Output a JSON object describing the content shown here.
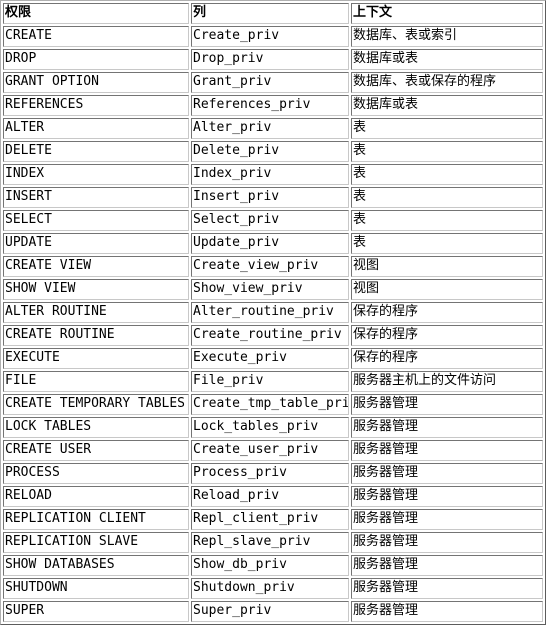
{
  "table": {
    "columns": [
      {
        "key": "privilege",
        "label": "权限"
      },
      {
        "key": "column",
        "label": "列"
      },
      {
        "key": "context",
        "label": "上下文"
      }
    ],
    "rows": [
      {
        "privilege": "CREATE",
        "column": "Create_priv",
        "context": "数据库、表或索引"
      },
      {
        "privilege": "DROP",
        "column": "Drop_priv",
        "context": "数据库或表"
      },
      {
        "privilege": "GRANT OPTION",
        "column": "Grant_priv",
        "context": "数据库、表或保存的程序"
      },
      {
        "privilege": "REFERENCES",
        "column": "References_priv",
        "context": "数据库或表"
      },
      {
        "privilege": "ALTER",
        "column": "Alter_priv",
        "context": "表"
      },
      {
        "privilege": "DELETE",
        "column": "Delete_priv",
        "context": "表"
      },
      {
        "privilege": "INDEX",
        "column": "Index_priv",
        "context": "表"
      },
      {
        "privilege": "INSERT",
        "column": "Insert_priv",
        "context": "表"
      },
      {
        "privilege": "SELECT",
        "column": "Select_priv",
        "context": "表"
      },
      {
        "privilege": "UPDATE",
        "column": "Update_priv",
        "context": "表"
      },
      {
        "privilege": "CREATE VIEW",
        "column": "Create_view_priv",
        "context": "视图"
      },
      {
        "privilege": "SHOW VIEW",
        "column": "Show_view_priv",
        "context": "视图"
      },
      {
        "privilege": "ALTER ROUTINE",
        "column": "Alter_routine_priv",
        "context": "保存的程序"
      },
      {
        "privilege": "CREATE ROUTINE",
        "column": "Create_routine_priv",
        "context": "保存的程序"
      },
      {
        "privilege": "EXECUTE",
        "column": "Execute_priv",
        "context": "保存的程序"
      },
      {
        "privilege": "FILE",
        "column": "File_priv",
        "context": "服务器主机上的文件访问"
      },
      {
        "privilege": "CREATE TEMPORARY TABLES",
        "column": "Create_tmp_table_priv",
        "context": "服务器管理"
      },
      {
        "privilege": "LOCK TABLES",
        "column": "Lock_tables_priv",
        "context": "服务器管理"
      },
      {
        "privilege": "CREATE USER",
        "column": "Create_user_priv",
        "context": "服务器管理"
      },
      {
        "privilege": "PROCESS",
        "column": "Process_priv",
        "context": "服务器管理"
      },
      {
        "privilege": "RELOAD",
        "column": "Reload_priv",
        "context": "服务器管理"
      },
      {
        "privilege": "REPLICATION CLIENT",
        "column": "Repl_client_priv",
        "context": "服务器管理"
      },
      {
        "privilege": "REPLICATION SLAVE",
        "column": "Repl_slave_priv",
        "context": "服务器管理"
      },
      {
        "privilege": "SHOW DATABASES",
        "column": "Show_db_priv",
        "context": "服务器管理"
      },
      {
        "privilege": "SHUTDOWN",
        "column": "Shutdown_priv",
        "context": "服务器管理"
      },
      {
        "privilege": "SUPER",
        "column": "Super_priv",
        "context": "服务器管理"
      }
    ]
  },
  "colors": {
    "text": "#000000",
    "background": "#ffffff",
    "border_outer": "#b0b0b0",
    "border_cell": "#c8c8c8"
  }
}
